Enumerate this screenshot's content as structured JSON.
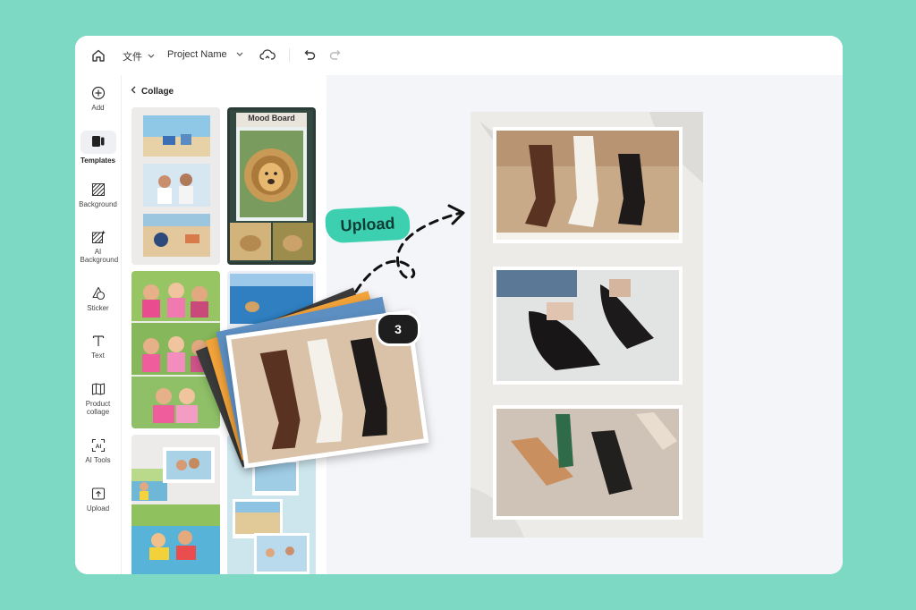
{
  "topbar": {
    "file_label": "文件",
    "project_name": "Project Name"
  },
  "sidebar": {
    "items": [
      {
        "label": "Add",
        "icon": "plus-circle-icon"
      },
      {
        "label": "Templates",
        "icon": "templates-icon",
        "active": true
      },
      {
        "label": "Background",
        "icon": "background-icon"
      },
      {
        "label": "AI Background",
        "icon": "ai-background-icon"
      },
      {
        "label": "Sticker",
        "icon": "sticker-icon"
      },
      {
        "label": "Text",
        "icon": "text-icon"
      },
      {
        "label": "Product collage",
        "icon": "product-collage-icon"
      },
      {
        "label": "AI Tools",
        "icon": "ai-tools-icon"
      },
      {
        "label": "Upload",
        "icon": "upload-icon"
      }
    ]
  },
  "panel": {
    "title": "Collage",
    "templates": [
      {
        "name": "beach-collage"
      },
      {
        "name": "mood-board",
        "title": "Mood Board"
      },
      {
        "name": "kids-collage"
      },
      {
        "name": "ocean-collage"
      },
      {
        "name": "family-pool-collage"
      },
      {
        "name": "beach-scrapbook-collage"
      }
    ]
  },
  "overlay": {
    "upload_label": "Upload",
    "photo_count": "3"
  },
  "colors": {
    "background": "#7dd8c4",
    "accent": "#3dd0b0",
    "canvas_bg": "#f4f5f8"
  }
}
